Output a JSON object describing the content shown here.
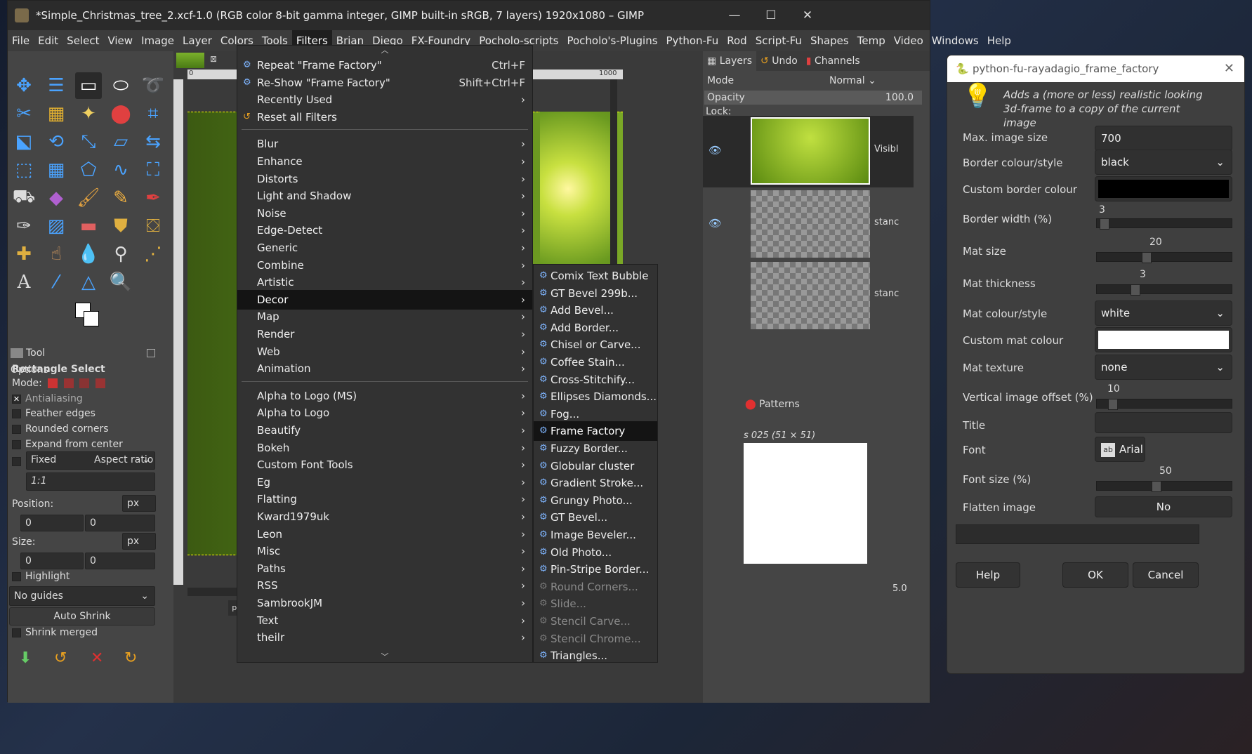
{
  "window": {
    "title": "*Simple_Christmas_tree_2.xcf-1.0 (RGB color 8-bit gamma integer, GIMP built-in sRGB, 7 layers) 1920x1080 – GIMP",
    "minimize": "—",
    "maximize": "☐",
    "close": "✕"
  },
  "menubar": [
    "File",
    "Edit",
    "Select",
    "View",
    "Image",
    "Layer",
    "Colors",
    "Tools",
    "Filters",
    "Brian",
    "Diego",
    "FX-Foundry",
    "Pocholo-scripts",
    "Pocholo's-Plugins",
    "Python-Fu",
    "Rod",
    "Script-Fu",
    "Shapes",
    "Temp",
    "Video",
    "Windows",
    "Help"
  ],
  "tool_options": {
    "tab_label": "Tool Options",
    "tool_name": "Rectangle Select",
    "mode_label": "Mode:",
    "antialiasing": "Antialiasing",
    "feather_edges": "Feather edges",
    "rounded_corners": "Rounded corners",
    "expand_from_center": "Expand from center",
    "fixed": "Fixed",
    "aspect_ratio": "Aspect ratio",
    "ratio_value": "1:1",
    "position_label": "Position:",
    "size_label": "Size:",
    "unit": "px",
    "pos_x": "0",
    "pos_y": "0",
    "size_x": "0",
    "size_y": "0",
    "highlight": "Highlight",
    "guides": "No guides",
    "auto_shrink": "Auto Shrink",
    "shrink_merged": "Shrink merged"
  },
  "canvas": {
    "ruler_0": "0",
    "ruler_1000": "1000",
    "unit": "px"
  },
  "layers_panel": {
    "tabs": [
      "Layers",
      "Undo",
      "Channels"
    ],
    "mode_label": "Mode",
    "mode_value": "Normal",
    "opacity_label": "Opacity",
    "opacity_value": "100.0",
    "lock_label": "Lock:",
    "layer_names": [
      "Visibl",
      "stanc",
      "stanc"
    ],
    "brushes_tab": "Patterns",
    "brush_name": "s 025 (51 × 51)",
    "spacing": "5.0"
  },
  "filters_menu": {
    "items": [
      {
        "label": "Repeat \"Frame Factory\"",
        "shortcut": "Ctrl+F",
        "icon": true
      },
      {
        "label": "Re-Show \"Frame Factory\"",
        "shortcut": "Shift+Ctrl+F",
        "icon": true
      },
      {
        "label": "Recently Used",
        "arrow": true
      },
      {
        "label": "Reset all Filters",
        "icon": true
      },
      {
        "label": "Blur",
        "arrow": true
      },
      {
        "label": "Enhance",
        "arrow": true
      },
      {
        "label": "Distorts",
        "arrow": true
      },
      {
        "label": "Light and Shadow",
        "arrow": true
      },
      {
        "label": "Noise",
        "arrow": true
      },
      {
        "label": "Edge-Detect",
        "arrow": true
      },
      {
        "label": "Generic",
        "arrow": true
      },
      {
        "label": "Combine",
        "arrow": true
      },
      {
        "label": "Artistic",
        "arrow": true
      },
      {
        "label": "Decor",
        "arrow": true,
        "selected": true
      },
      {
        "label": "Map",
        "arrow": true
      },
      {
        "label": "Render",
        "arrow": true
      },
      {
        "label": "Web",
        "arrow": true
      },
      {
        "label": "Animation",
        "arrow": true
      },
      {
        "label": "Alpha to Logo (MS)",
        "arrow": true
      },
      {
        "label": "Alpha to Logo",
        "arrow": true
      },
      {
        "label": "Beautify",
        "arrow": true
      },
      {
        "label": "Bokeh",
        "arrow": true
      },
      {
        "label": "Custom Font Tools",
        "arrow": true
      },
      {
        "label": "Eg",
        "arrow": true
      },
      {
        "label": "Flatting",
        "arrow": true
      },
      {
        "label": "Kward1979uk",
        "arrow": true
      },
      {
        "label": "Leon",
        "arrow": true
      },
      {
        "label": "Misc",
        "arrow": true
      },
      {
        "label": "Paths",
        "arrow": true
      },
      {
        "label": "RSS",
        "arrow": true
      },
      {
        "label": "SambrookJM",
        "arrow": true
      },
      {
        "label": "Text",
        "arrow": true
      },
      {
        "label": "theilr",
        "arrow": true
      }
    ]
  },
  "decor_menu": {
    "items": [
      {
        "label": "Comix Text Bubble"
      },
      {
        "label": "GT Bevel 299b..."
      },
      {
        "label": "Add Bevel..."
      },
      {
        "label": "Add Border..."
      },
      {
        "label": "Chisel or Carve..."
      },
      {
        "label": "Coffee Stain..."
      },
      {
        "label": "Cross-Stitchify..."
      },
      {
        "label": "Ellipses Diamonds..."
      },
      {
        "label": "Fog..."
      },
      {
        "label": "Frame Factory",
        "selected": true
      },
      {
        "label": "Fuzzy Border..."
      },
      {
        "label": "Globular cluster"
      },
      {
        "label": "Gradient Stroke..."
      },
      {
        "label": "Grungy Photo..."
      },
      {
        "label": "GT Bevel..."
      },
      {
        "label": "Image Beveler..."
      },
      {
        "label": "Old Photo..."
      },
      {
        "label": "Pin-Stripe Border..."
      },
      {
        "label": "Round Corners...",
        "disabled": true
      },
      {
        "label": "Slide...",
        "disabled": true
      },
      {
        "label": "Stencil Carve...",
        "disabled": true
      },
      {
        "label": "Stencil Chrome...",
        "disabled": true
      },
      {
        "label": "Triangles..."
      }
    ]
  },
  "dialog": {
    "title": "python-fu-rayadagio_frame_factory",
    "description": "Adds a (more or less) realistic looking 3d-frame to a copy of the current image",
    "max_image_size_label": "Max. image size",
    "max_image_size": "700",
    "border_style_label": "Border colour/style",
    "border_style": "black",
    "custom_border_label": "Custom border colour",
    "border_width_label": "Border width (%)",
    "border_width": "3",
    "mat_size_label": "Mat size",
    "mat_size": "20",
    "mat_thickness_label": "Mat thickness",
    "mat_thickness": "3",
    "mat_style_label": "Mat colour/style",
    "mat_style": "white",
    "custom_mat_label": "Custom mat colour",
    "mat_texture_label": "Mat texture",
    "mat_texture": "none",
    "vertical_offset_label": "Vertical image offset (%)",
    "vertical_offset": "10",
    "title_label": "Title",
    "title_value": "",
    "font_label": "Font",
    "font_value": "Arial",
    "font_size_label": "Font size (%)",
    "font_size": "50",
    "flatten_label": "Flatten image",
    "flatten_value": "No",
    "help": "Help",
    "ok": "OK",
    "cancel": "Cancel"
  }
}
